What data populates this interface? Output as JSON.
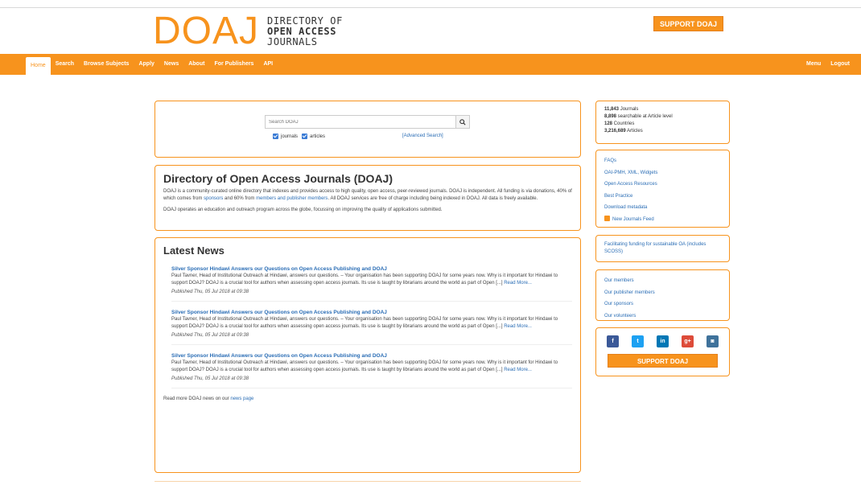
{
  "header": {
    "logo_mark": "DOAJ",
    "logo_lines": [
      "DIRECTORY OF",
      "OPEN ACCESS",
      "JOURNALS"
    ],
    "support_label": "SUPPORT DOAJ"
  },
  "nav": {
    "items": [
      "Home",
      "Search",
      "Browse Subjects",
      "Apply",
      "News",
      "About",
      "For Publishers",
      "API"
    ],
    "right": [
      "Menu",
      "Logout"
    ]
  },
  "search": {
    "placeholder": "Search DOAJ",
    "opt_journals": "journals",
    "opt_articles": "articles",
    "advanced": "[Advanced Search]"
  },
  "intro": {
    "title": "Directory of Open Access Journals (DOAJ)",
    "p1_a": "DOAJ is a community-curated online directory that indexes and provides access to high quality, open access, peer-reviewed journals. DOAJ is independent. All funding is via donations, 40% of which comes from ",
    "p1_link1": "sponsors",
    "p1_b": " and 60% from ",
    "p1_link2": "members and publisher members",
    "p1_c": ". All DOAJ services are free of charge including being indexed in DOAJ. All data is freely available.",
    "p2": "DOAJ operates an education and outreach program across the globe, focussing on improving the quality of applications submitted."
  },
  "news": {
    "title": "Latest News",
    "items": [
      {
        "headline": "Silver Sponsor Hindawi Answers our Questions on Open Access Publishing and DOAJ",
        "body": "Paul Tavner, Head of Institutional Outreach at Hindawi, answers our questions. – Your organisation has been supporting DOAJ for some years now. Why is it important for Hindawi to support DOAJ? DOAJ is a crucial tool for authors when assessing open access journals. Its use is taught by librarians around the world as part of Open [...] ",
        "more": "Read More...",
        "date": "Published Thu, 05 Jul 2018 at 09:38"
      },
      {
        "headline": "Silver Sponsor Hindawi Answers our Questions on Open Access Publishing and DOAJ",
        "body": "Paul Tavner, Head of Institutional Outreach at Hindawi, answers our questions. – Your organisation has been supporting DOAJ for some years now. Why is it important for Hindawi to support DOAJ? DOAJ is a crucial tool for authors when assessing open access journals. Its use is taught by librarians around the world as part of Open [...] ",
        "more": "Read More...",
        "date": "Published Thu, 05 Jul 2018 at 09:38"
      },
      {
        "headline": "Silver Sponsor Hindawi Answers our Questions on Open Access Publishing and DOAJ",
        "body": "Paul Tavner, Head of Institutional Outreach at Hindawi, answers our questions. – Your organisation has been supporting DOAJ for some years now. Why is it important for Hindawi to support DOAJ? DOAJ is a crucial tool for authors when assessing open access journals. Its use is taught by librarians around the world as part of Open [...] ",
        "more": "Read More...",
        "date": "Published Thu, 05 Jul 2018 at 09:38"
      }
    ],
    "footer_text": "Read more DOAJ news on our ",
    "footer_link": "news page"
  },
  "sidebar": {
    "stats": [
      {
        "num": "11,843",
        "label": " Journals"
      },
      {
        "num": "8,898",
        "label": " searchable at Article level"
      },
      {
        "num": "128",
        "label": " Countries"
      },
      {
        "num": "3,216,689",
        "label": " Articles"
      }
    ],
    "links": [
      "FAQs",
      "OAI-PMH, XML, Widgets",
      "Open Access Resources",
      "Best Practice",
      "Download metadata",
      "New Journals Feed"
    ],
    "funding": "Facilitating funding for sustainable OA (includes SCOSS)",
    "members": [
      "Our members",
      "Our publisher members",
      "Our sponsors",
      "Our volunteers"
    ],
    "social": [
      {
        "name": "facebook-icon",
        "glyph": "f",
        "color": "#3b5998"
      },
      {
        "name": "twitter-icon",
        "glyph": "t",
        "color": "#1da1f2"
      },
      {
        "name": "linkedin-icon",
        "glyph": "in",
        "color": "#0077b5"
      },
      {
        "name": "googleplus-icon",
        "glyph": "g+",
        "color": "#dd4b39"
      },
      {
        "name": "instagram-icon",
        "glyph": "◙",
        "color": "#3f729b"
      }
    ],
    "support_label": "SUPPORT DOAJ"
  },
  "colors": {
    "accent": "#f7931d",
    "link": "#2a6db5"
  }
}
